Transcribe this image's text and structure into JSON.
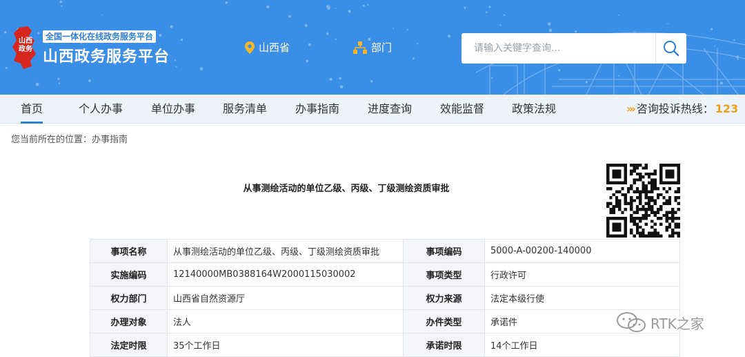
{
  "header": {
    "logo_text": "山西政务",
    "tagline": "全国一体化在线政务服务平台",
    "site_title": "山西政务服务平台",
    "location": "山西省",
    "department": "部门",
    "search_placeholder": "请输入关键字查询...",
    "colors": {
      "header_bg": "#3a8ee6",
      "accent": "#2f7fd8",
      "hotline_num": "#e8a21b"
    }
  },
  "nav": {
    "items": [
      "首页",
      "个人办事",
      "单位办事",
      "服务清单",
      "办事指南",
      "进度查询",
      "效能监督",
      "政策法规"
    ],
    "active": "首页",
    "hotline_label": "咨询投诉热线：",
    "hotline_number": "123"
  },
  "breadcrumb": "您当前所在的位置：办事指南",
  "item": {
    "title": "从事测绘活动的单位乙级、丙级、丁级测绘资质审批",
    "rows": [
      {
        "k1": "事项名称",
        "v1": "从事测绘活动的单位乙级、丙级、丁级测绘资质审批",
        "k2": "事项编码",
        "v2": "5000-A-00200-140000"
      },
      {
        "k1": "实施编码",
        "v1": "12140000MB0388164W2000115030002",
        "k2": "事项类型",
        "v2": "行政许可"
      },
      {
        "k1": "权力部门",
        "v1": "山西省自然资源厅",
        "k2": "权力来源",
        "v2": "法定本级行使"
      },
      {
        "k1": "办理对象",
        "v1": "法人",
        "k2": "办件类型",
        "v2": "承诺件"
      },
      {
        "k1": "法定时限",
        "v1": "35个工作日",
        "k2": "承诺时限",
        "v2": "14个工作日"
      }
    ]
  },
  "watermark": "RTK之家",
  "icons": [
    "location-pin-icon",
    "org-chart-icon",
    "search-icon",
    "qr-code-icon",
    "wechat-icon"
  ]
}
